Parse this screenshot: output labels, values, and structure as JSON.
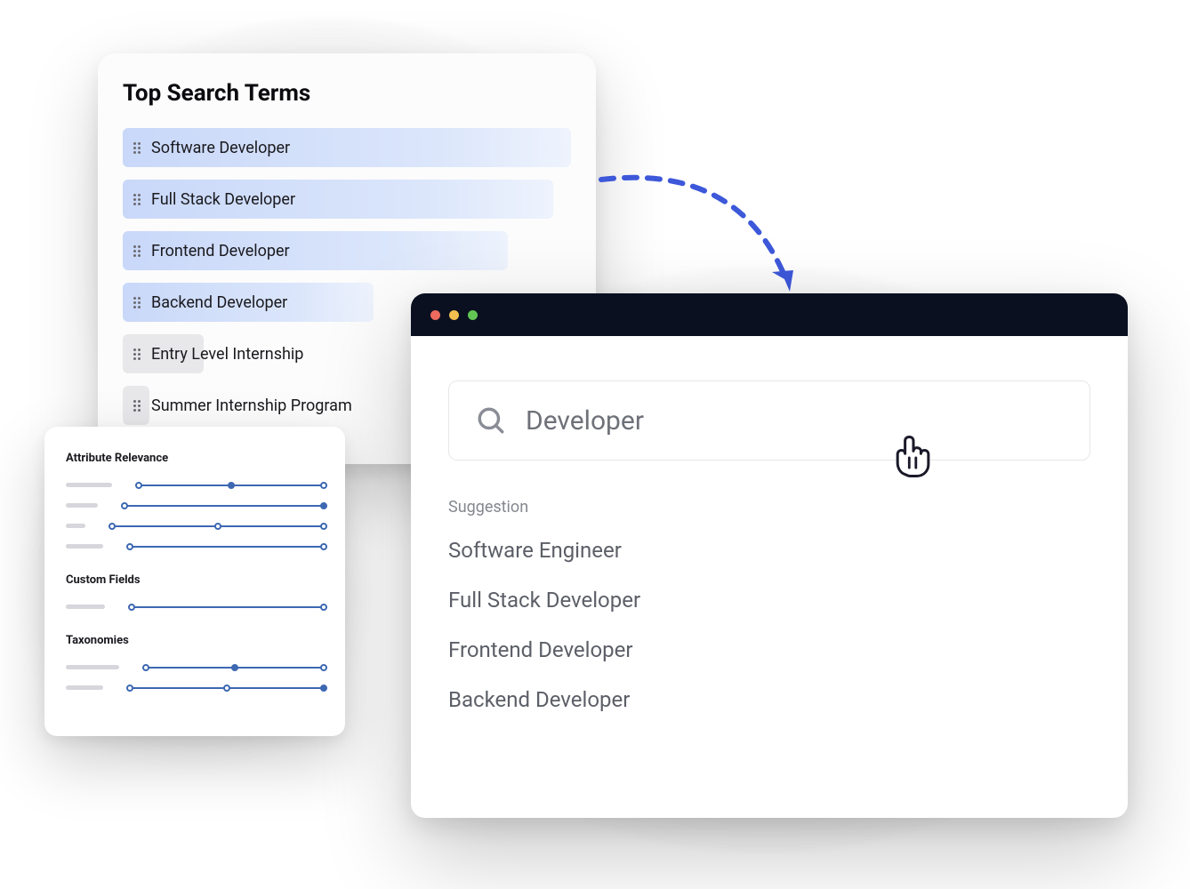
{
  "searchTerms": {
    "title": "Top Search Terms",
    "items": [
      {
        "label": "Software Developer",
        "width": "100%",
        "tone": "blue"
      },
      {
        "label": "Full Stack Developer",
        "width": "96%",
        "tone": "blue"
      },
      {
        "label": "Frontend Developer",
        "width": "86%",
        "tone": "blue"
      },
      {
        "label": "Backend Developer",
        "width": "56%",
        "tone": "blue"
      },
      {
        "label": "Entry Level Internship",
        "width": "18%",
        "tone": "grey"
      },
      {
        "label": "Summer Internship Program",
        "width": "6%",
        "tone": "grey"
      }
    ]
  },
  "sliders": {
    "sections": [
      {
        "title": "Attribute Relevance",
        "rows": [
          {
            "labelWidth": 52,
            "handles": [
              0,
              50,
              100
            ],
            "filled": [
              50
            ]
          },
          {
            "labelWidth": 36,
            "handles": [
              0,
              100
            ],
            "filled": [
              100
            ]
          },
          {
            "labelWidth": 22,
            "handles": [
              0,
              50,
              100
            ],
            "filled": []
          },
          {
            "labelWidth": 42,
            "handles": [
              0,
              100
            ],
            "filled": []
          }
        ]
      },
      {
        "title": "Custom Fields",
        "rows": [
          {
            "labelWidth": 44,
            "handles": [
              0,
              100
            ],
            "filled": []
          }
        ]
      },
      {
        "title": "Taxonomies",
        "rows": [
          {
            "labelWidth": 60,
            "handles": [
              0,
              50,
              100
            ],
            "filled": [
              50
            ]
          },
          {
            "labelWidth": 42,
            "handles": [
              0,
              50,
              100
            ],
            "filled": [
              100
            ]
          }
        ]
      }
    ]
  },
  "browser": {
    "search": {
      "value": "Developer"
    },
    "suggestionLabel": "Suggestion",
    "suggestions": [
      "Software Engineer",
      "Full Stack Developer",
      "Frontend Developer",
      "Backend Developer"
    ]
  },
  "colors": {
    "accent": "#3d58d9"
  }
}
